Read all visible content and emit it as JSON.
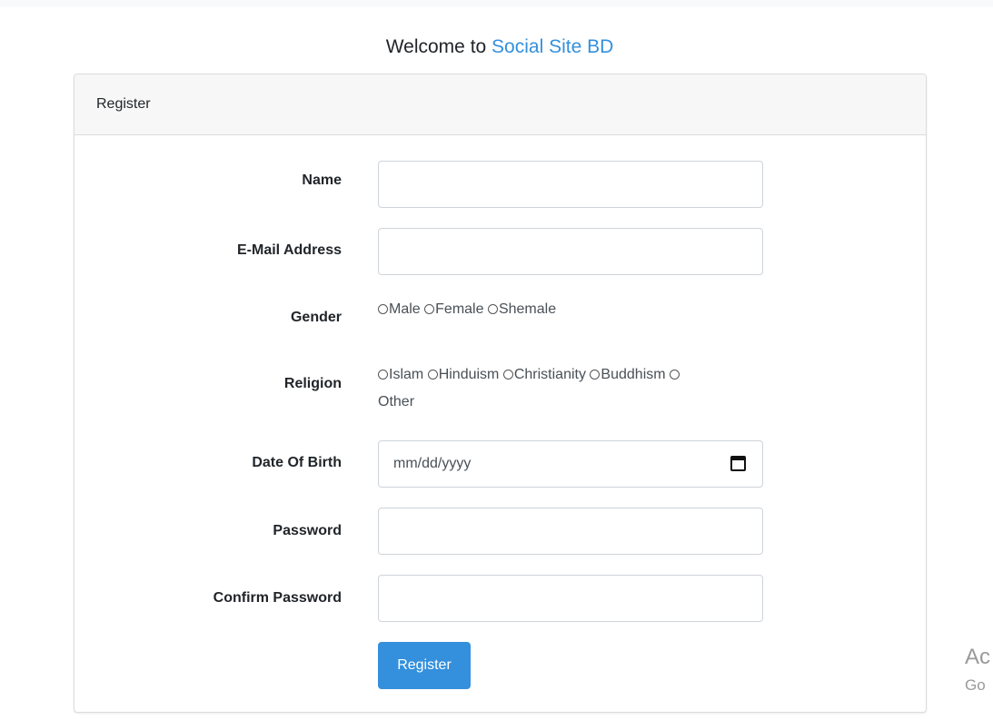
{
  "header": {
    "welcome_prefix": "Welcome to ",
    "brand": "Social Site BD"
  },
  "card": {
    "title": "Register"
  },
  "form": {
    "name_label": "Name",
    "name_value": "",
    "email_label": "E-Mail Address",
    "email_value": "",
    "gender_label": "Gender",
    "gender_options": [
      "Male",
      "Female",
      "Shemale"
    ],
    "religion_label": "Religion",
    "religion_options": [
      "Islam",
      "Hinduism",
      "Christianity",
      "Buddhism",
      "Other"
    ],
    "dob_label": "Date Of Birth",
    "dob_placeholder": "mm/dd/yyyy",
    "password_label": "Password",
    "password_value": "",
    "confirm_password_label": "Confirm Password",
    "confirm_password_value": "",
    "submit_label": "Register"
  },
  "watermark": {
    "line1": "Ac",
    "line2": "Go"
  },
  "colors": {
    "accent": "#3490dc",
    "header_bg": "#f7f7f7",
    "border": "#dcdcdc"
  },
  "icons": {
    "calendar": "calendar-icon",
    "radio": "radio-circle"
  }
}
